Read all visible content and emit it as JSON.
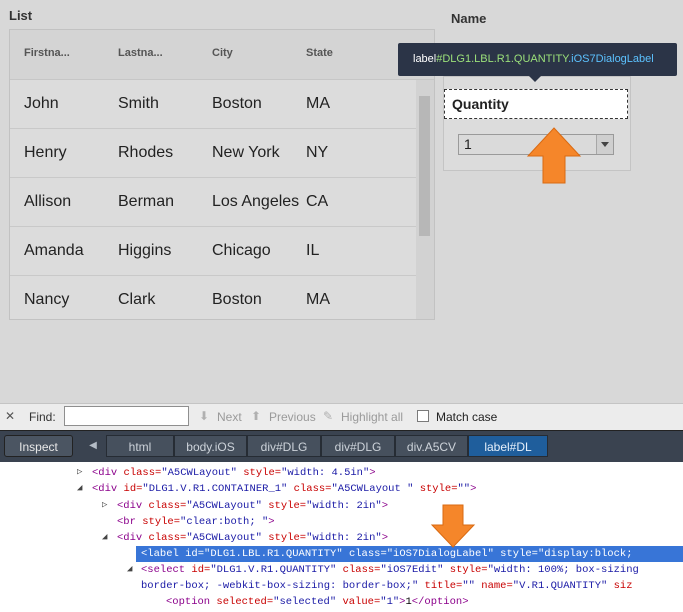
{
  "list": {
    "title": "List",
    "columns": [
      "Firstna...",
      "Lastna...",
      "City",
      "State"
    ],
    "rows": [
      [
        "John",
        "Smith",
        "Boston",
        "MA"
      ],
      [
        "Henry",
        "Rhodes",
        "New York",
        "NY"
      ],
      [
        "Allison",
        "Berman",
        "Los Angeles",
        "CA"
      ],
      [
        "Amanda",
        "Higgins",
        "Chicago",
        "IL"
      ],
      [
        "Nancy",
        "Clark",
        "Boston",
        "MA"
      ]
    ]
  },
  "detail": {
    "name_label": "Name",
    "quantity_label": "Quantity",
    "quantity_value": "1"
  },
  "tooltip": {
    "prefix": "label",
    "id": "#DLG1.LBL.R1.QUANTITY",
    "cls": ".iOS7DialogLabel"
  },
  "findbar": {
    "close": "✕",
    "find_label": "Find:",
    "find_value": "",
    "next": "Next",
    "previous": "Previous",
    "highlight_all": "Highlight all",
    "match_case": "Match case"
  },
  "inspector": {
    "inspect_label": "Inspect",
    "breadcrumbs": [
      "html",
      "body.iOS",
      "div#DLG",
      "div#DLG",
      "div.A5CV",
      "label#DL"
    ]
  },
  "markup": {
    "lines": [
      {
        "t": "▷",
        "parts": [
          [
            "tag",
            "<div "
          ],
          [
            "attr",
            "class="
          ],
          [
            "val",
            "\"A5CWLayout\""
          ],
          [
            "attr",
            " style="
          ],
          [
            "val",
            "\"width: 4.5in\""
          ],
          [
            "tag",
            ">"
          ]
        ]
      },
      {
        "t": "◢",
        "parts": [
          [
            "tag",
            "<div "
          ],
          [
            "attr",
            "id="
          ],
          [
            "val",
            "\"DLG1.V.R1.CONTAINER_1\""
          ],
          [
            "attr",
            " class="
          ],
          [
            "val",
            "\"A5CWLayout \""
          ],
          [
            "attr",
            " style="
          ],
          [
            "val",
            "\"\""
          ],
          [
            "tag",
            ">"
          ]
        ]
      },
      {
        "t": "▷",
        "parts": [
          [
            "tag",
            "<div "
          ],
          [
            "attr",
            "class="
          ],
          [
            "val",
            "\"A5CWLayout\""
          ],
          [
            "attr",
            " style="
          ],
          [
            "val",
            "\"width: 2in\""
          ],
          [
            "tag",
            ">"
          ]
        ]
      },
      {
        "t": "",
        "parts": [
          [
            "tag",
            "<br "
          ],
          [
            "attr",
            "style="
          ],
          [
            "val",
            "\"clear:both; \""
          ],
          [
            "tag",
            ">"
          ]
        ]
      },
      {
        "t": "◢",
        "parts": [
          [
            "tag",
            "<div "
          ],
          [
            "attr",
            "class="
          ],
          [
            "val",
            "\"A5CWLayout\""
          ],
          [
            "attr",
            " style="
          ],
          [
            "val",
            "\"width: 2in\""
          ],
          [
            "tag",
            ">"
          ]
        ]
      },
      {
        "t": "",
        "parts": [
          [
            "tag",
            "<label "
          ],
          [
            "attr",
            "id="
          ],
          [
            "val",
            "\"DLG1.LBL.R1.QUANTITY\""
          ],
          [
            "attr",
            " class="
          ],
          [
            "val",
            "\"iOS7DialogLabel\""
          ],
          [
            "attr",
            " style="
          ],
          [
            "val",
            "\"display:block;"
          ]
        ]
      },
      {
        "t": "◢",
        "parts": [
          [
            "tag",
            "<select "
          ],
          [
            "attr",
            "id="
          ],
          [
            "val",
            "\"DLG1.V.R1.QUANTITY\""
          ],
          [
            "attr",
            " class="
          ],
          [
            "val",
            "\"iOS7Edit\""
          ],
          [
            "attr",
            " style="
          ],
          [
            "val",
            "\"width: 100%; box-sizing"
          ]
        ]
      },
      {
        "t": "",
        "parts": [
          [
            "val",
            "border-box; -webkit-box-sizing: border-box;\""
          ],
          [
            "attr",
            " title="
          ],
          [
            "val",
            "\"\""
          ],
          [
            "attr",
            " name="
          ],
          [
            "val",
            "\"V.R1.QUANTITY\""
          ],
          [
            "attr",
            " siz"
          ]
        ]
      },
      {
        "t": "",
        "parts": [
          [
            "tag",
            "<option "
          ],
          [
            "attr",
            "selected="
          ],
          [
            "val",
            "\"selected\""
          ],
          [
            "attr",
            " value="
          ],
          [
            "val",
            "\"1\""
          ],
          [
            "tag",
            ">"
          ],
          [
            "txt",
            "1"
          ],
          [
            "tag",
            "</option>"
          ]
        ]
      }
    ]
  },
  "colors": {
    "accent_orange": "#f5862a",
    "selection_blue": "#3875d7",
    "tooltip_bg": "#2b3447"
  }
}
